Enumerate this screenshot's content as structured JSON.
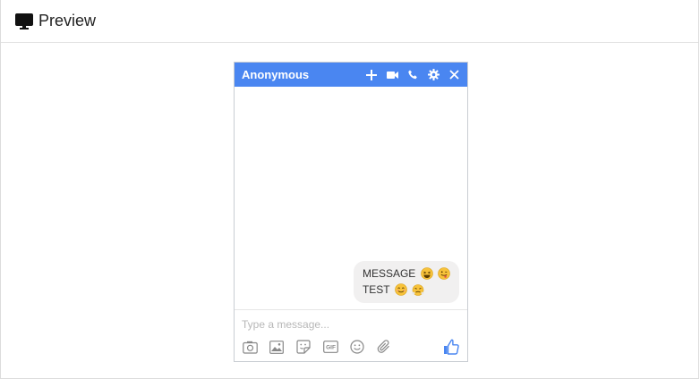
{
  "panel": {
    "title": "Preview",
    "title_icon": "monitor-icon"
  },
  "chat": {
    "contact_name": "Anonymous",
    "header_icons": [
      "plus-icon",
      "video-camera-icon",
      "phone-icon",
      "gear-icon",
      "close-icon"
    ],
    "accent_color": "#4a86f1",
    "message": {
      "line1": "MESSAGE",
      "line2": "TEST",
      "line1_emojis": [
        "grinning-squint-emoji",
        "winking-tongue-emoji"
      ],
      "line2_emojis": [
        "smiling-emoji",
        "angry-steam-emoji"
      ]
    },
    "composer": {
      "placeholder": "Type a message...",
      "tools": [
        "camera-icon",
        "image-icon",
        "sticker-icon",
        "gif-icon",
        "emoji-icon",
        "paperclip-icon"
      ],
      "gif_label": "GIF",
      "send_icon": "thumbs-up-icon"
    }
  }
}
